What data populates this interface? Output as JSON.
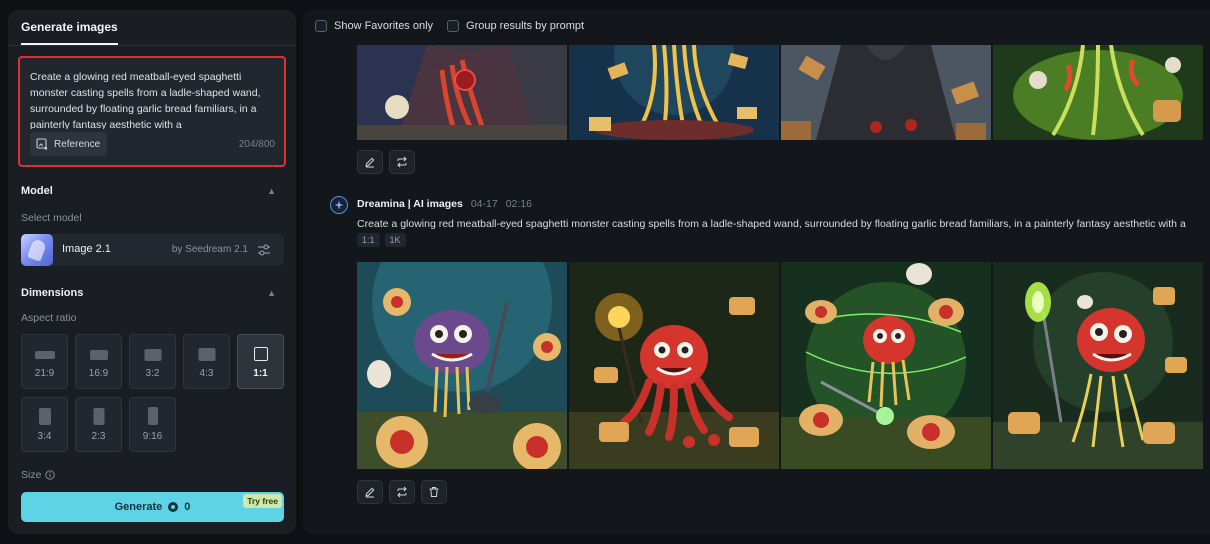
{
  "sidebar": {
    "tab_label": "Generate images",
    "prompt": {
      "text": "Create a glowing red meatball-eyed spaghetti monster casting spells from a ladle-shaped wand, surrounded by floating garlic bread familiars, in a painterly fantasy aesthetic with a",
      "reference_label": "Reference",
      "counter": "204/800",
      "border_color": "#e0312f"
    },
    "model": {
      "section_title": "Model",
      "select_label": "Select model",
      "name": "Image 2.1",
      "provider": "by Seedream 2.1"
    },
    "dimensions": {
      "section_title": "Dimensions",
      "aspect_label": "Aspect ratio",
      "ratios": [
        "21:9",
        "16:9",
        "3:2",
        "4:3",
        "1:1",
        "3:4",
        "2:3",
        "9:16"
      ],
      "selected": "1:1"
    },
    "size_label": "Size",
    "generate": {
      "label": "Generate",
      "cost": "0",
      "badge": "Try free",
      "color": "#5fd3e6"
    }
  },
  "main": {
    "filters": {
      "favorites_label": "Show Favorites only",
      "group_label": "Group results by prompt"
    },
    "generation": {
      "author": "Dreamina | AI images",
      "date": "04-17",
      "time": "02:16",
      "prompt": "Create a glowing red meatball-eyed spaghetti monster casting spells from a ladle-shaped wand, surrounded by floating garlic bread familiars, in a painterly fantasy aesthetic with a",
      "chips": [
        "1:1",
        "1K"
      ]
    },
    "top_images": [
      "dark-robed wizard with red noodles",
      "golden spaghetti tower with bread",
      "robed figure with bread slices",
      "green glowing noodle swamp"
    ],
    "bottom_images": [
      "purple monster with ladle",
      "red octopus monster with torch",
      "red spaghetti monster in green magic",
      "red monster with glowing spoon wand"
    ]
  }
}
